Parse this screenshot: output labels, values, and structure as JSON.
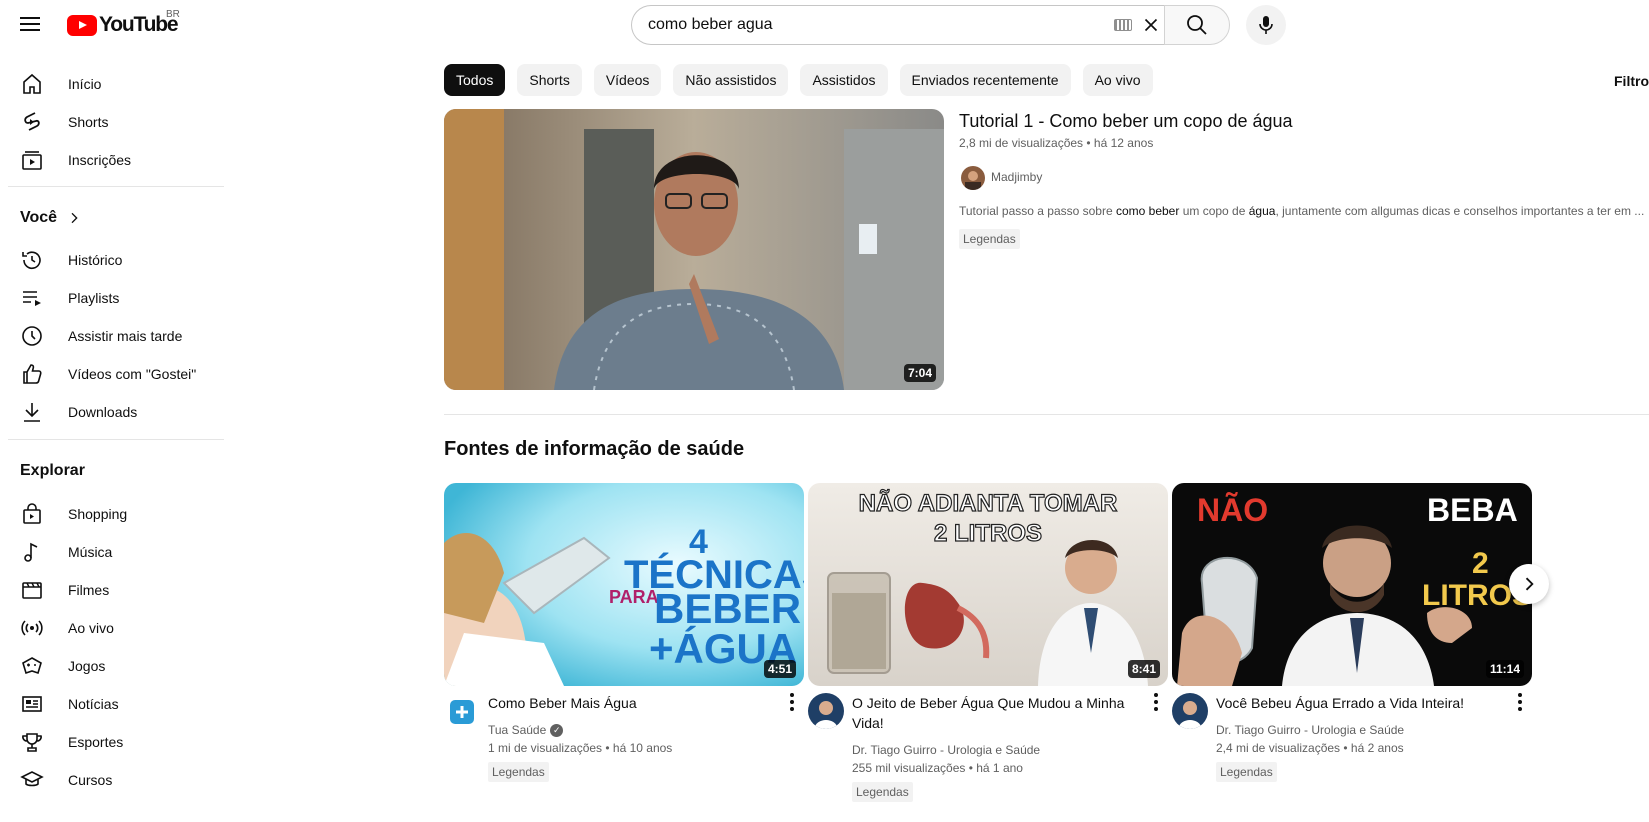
{
  "header": {
    "logo_text": "YouTube",
    "country": "BR",
    "search_value": "como beber agua"
  },
  "sidebar": {
    "main": [
      {
        "label": "Início",
        "icon": "home-icon"
      },
      {
        "label": "Shorts",
        "icon": "shorts-icon"
      },
      {
        "label": "Inscrições",
        "icon": "subscriptions-icon"
      }
    ],
    "you_title": "Você",
    "you": [
      {
        "label": "Histórico",
        "icon": "history-icon"
      },
      {
        "label": "Playlists",
        "icon": "playlists-icon"
      },
      {
        "label": "Assistir mais tarde",
        "icon": "watch-later-icon"
      },
      {
        "label": "Vídeos com \"Gostei\"",
        "icon": "like-icon"
      },
      {
        "label": "Downloads",
        "icon": "download-icon"
      }
    ],
    "explore_title": "Explorar",
    "explore": [
      {
        "label": "Shopping",
        "icon": "shopping-bag-icon"
      },
      {
        "label": "Música",
        "icon": "music-note-icon"
      },
      {
        "label": "Filmes",
        "icon": "clapperboard-icon"
      },
      {
        "label": "Ao vivo",
        "icon": "live-icon"
      },
      {
        "label": "Jogos",
        "icon": "gamepad-icon"
      },
      {
        "label": "Notícias",
        "icon": "newspaper-icon"
      },
      {
        "label": "Esportes",
        "icon": "trophy-icon"
      },
      {
        "label": "Cursos",
        "icon": "graduation-cap-icon"
      }
    ]
  },
  "chips": [
    "Todos",
    "Shorts",
    "Vídeos",
    "Não assistidos",
    "Assistidos",
    "Enviados recentemente",
    "Ao vivo"
  ],
  "filters_label": "Filtros",
  "main_video": {
    "title": "Tutorial 1 - Como beber um copo de água",
    "meta": "2,8 mi de visualizações • há 12 anos",
    "channel": "Madjimby",
    "desc_a": "Tutorial passo a passo sobre ",
    "desc_b": "como beber",
    "desc_c": " um copo de ",
    "desc_d": "água",
    "desc_e": ", juntamente com allgumas dicas e conselhos importantes a ter em ...",
    "badge": "Legendas",
    "duration": "7:04"
  },
  "section": {
    "title": "Fontes de informação de saúde",
    "cards": [
      {
        "title": "Como Beber Mais Água",
        "channel": "Tua Saúde",
        "meta": "1 mi de visualizações • há 10 anos",
        "badge": "Legendas",
        "duration": "4:51",
        "thumb_text_1": "4",
        "thumb_text_2": "TÉCNICAS",
        "thumb_text_3": "PARA",
        "thumb_text_4": "BEBER",
        "thumb_text_5": "+ÁGUA"
      },
      {
        "title": "O Jeito de Beber Água Que Mudou a Minha Vida!",
        "channel": "Dr. Tiago Guirro - Urologia e Saúde",
        "meta": "255 mil visualizações • há 1 ano",
        "badge": "Legendas",
        "duration": "8:41",
        "thumb_text_1": "NÃO ADIANTA TOMAR",
        "thumb_text_2": "2 LITROS"
      },
      {
        "title": "Você Bebeu Água Errado a Vida Inteira!",
        "channel": "Dr. Tiago Guirro - Urologia e Saúde",
        "meta": "2,4 mi de visualizações • há 2 anos",
        "badge": "Legendas",
        "duration": "11:14",
        "thumb_text_1": "NÃO",
        "thumb_text_2": "BEBA",
        "thumb_text_3": "2",
        "thumb_text_4": "LITROS"
      }
    ]
  },
  "colors": {
    "brand_red": "#ff0000",
    "text_primary": "#0f0f0f",
    "text_secondary": "#606060",
    "chip_bg": "#f2f2f2"
  }
}
